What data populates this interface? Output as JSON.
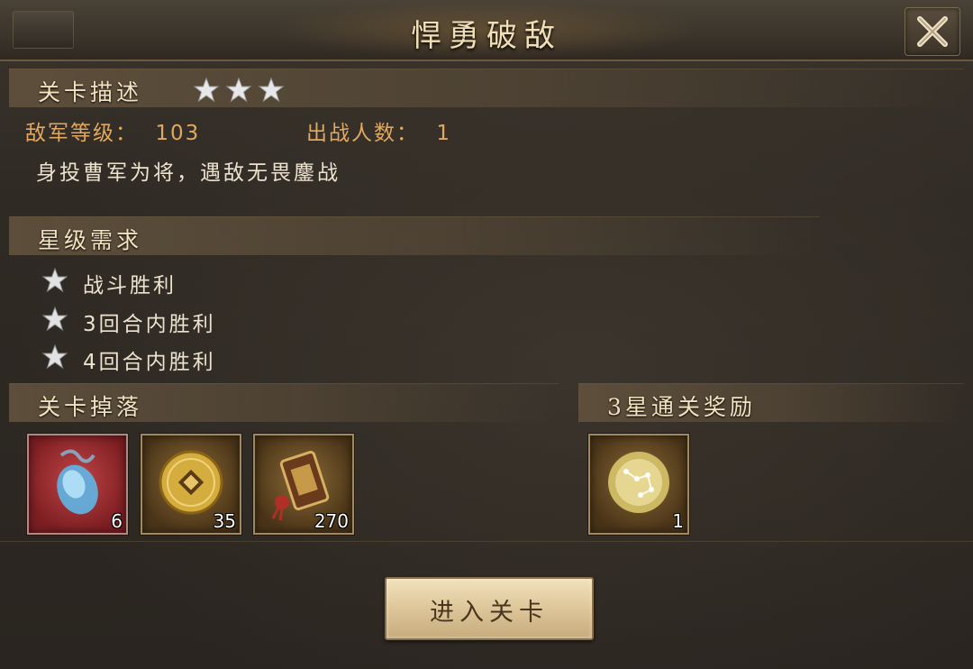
{
  "title": "悍勇破敌",
  "close_icon": "close-x-icon",
  "description_section": {
    "title": "关卡描述",
    "stars_earned": 3,
    "stars_total": 3,
    "enemy_level_label": "敌军等级：",
    "enemy_level": "103",
    "troop_count_label": "出战人数：",
    "troop_count": "1",
    "description": "身投曹军为将，遇敌无畏鏖战"
  },
  "star_requirements": {
    "title": "星级需求",
    "items": [
      {
        "label": "战斗胜利"
      },
      {
        "label": "3回合内胜利"
      },
      {
        "label": "4回合内胜利"
      }
    ]
  },
  "drops": {
    "title": "关卡掉落",
    "items": [
      {
        "icon": "blue-soul-gem-icon",
        "count": "6",
        "rarity": "red"
      },
      {
        "icon": "gold-coin-icon",
        "count": "35",
        "rarity": "gold"
      },
      {
        "icon": "war-banner-token-icon",
        "count": "270",
        "rarity": "gold"
      }
    ]
  },
  "three_star_reward": {
    "title": "3星通关奖励",
    "items": [
      {
        "icon": "constellation-orb-icon",
        "count": "1",
        "rarity": "gold"
      }
    ]
  },
  "enter_button": "进入关卡",
  "colors": {
    "title_text": "#f1dfb7",
    "info_text": "#e0a860",
    "body_text": "#ece2cf",
    "button_bg": "#ddc69a"
  }
}
